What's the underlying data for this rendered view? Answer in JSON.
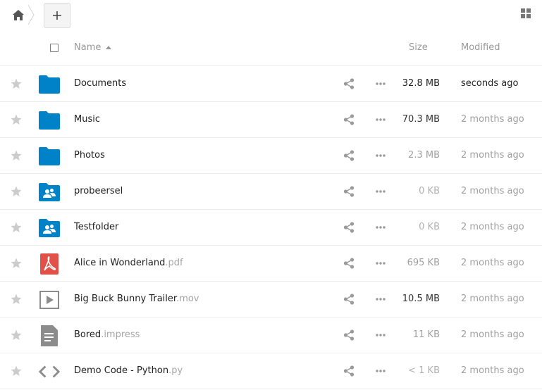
{
  "toolbar": {
    "home_icon": "home-icon",
    "new_icon": "plus-icon",
    "view_toggle_icon": "grid-view-icon"
  },
  "header": {
    "name_label": "Name",
    "size_label": "Size",
    "modified_label": "Modified"
  },
  "colors": {
    "folder": "#0082c9",
    "pdf": "#e2504a",
    "muted_icon": "#8c8c8c",
    "star": "#cccccc"
  },
  "files": [
    {
      "name": "Documents",
      "ext": "",
      "type": "folder",
      "size": "32.8 MB",
      "modified": "seconds ago",
      "size_color": "#222222",
      "modified_color": "#222222"
    },
    {
      "name": "Music",
      "ext": "",
      "type": "folder",
      "size": "70.3 MB",
      "modified": "2 months ago",
      "size_color": "#333333",
      "modified_color": "#a0a0a0"
    },
    {
      "name": "Photos",
      "ext": "",
      "type": "folder",
      "size": "2.3 MB",
      "modified": "2 months ago",
      "size_color": "#a0a0a0",
      "modified_color": "#a0a0a0"
    },
    {
      "name": "probeersel",
      "ext": "",
      "type": "shared-folder",
      "size": "0 KB",
      "modified": "2 months ago",
      "size_color": "#b0b0b0",
      "modified_color": "#a0a0a0"
    },
    {
      "name": "Testfolder",
      "ext": "",
      "type": "shared-folder",
      "size": "0 KB",
      "modified": "2 months ago",
      "size_color": "#b0b0b0",
      "modified_color": "#a0a0a0"
    },
    {
      "name": "Alice in Wonderland",
      "ext": ".pdf",
      "type": "pdf",
      "size": "695 KB",
      "modified": "2 months ago",
      "size_color": "#a0a0a0",
      "modified_color": "#a0a0a0"
    },
    {
      "name": "Big Buck Bunny Trailer",
      "ext": ".mov",
      "type": "video",
      "size": "10.5 MB",
      "modified": "2 months ago",
      "size_color": "#333333",
      "modified_color": "#a0a0a0"
    },
    {
      "name": "Bored",
      "ext": ".impress",
      "type": "document",
      "size": "11 KB",
      "modified": "2 months ago",
      "size_color": "#a0a0a0",
      "modified_color": "#a0a0a0"
    },
    {
      "name": "Demo Code - Python",
      "ext": ".py",
      "type": "code",
      "size": "< 1 KB",
      "modified": "2 months ago",
      "size_color": "#b0b0b0",
      "modified_color": "#a0a0a0"
    }
  ]
}
